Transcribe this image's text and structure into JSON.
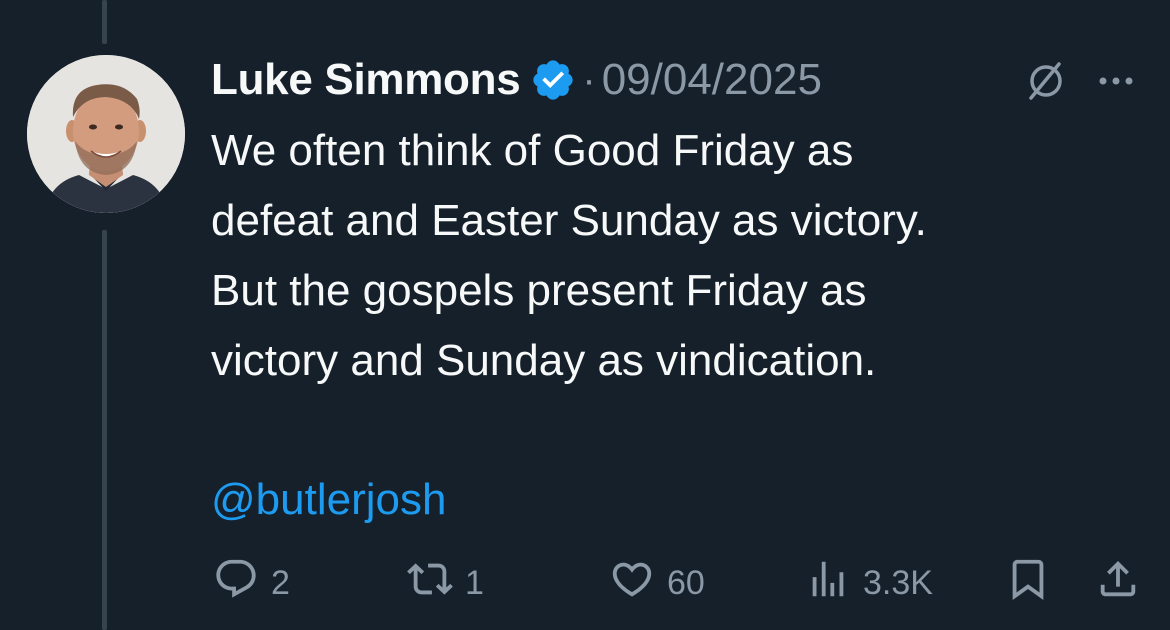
{
  "tweet": {
    "author_name": "Luke Simmons",
    "verified": true,
    "separator": "·",
    "date": "09/04/2025",
    "text": "We often think of Good Friday as\ndefeat and Easter Sunday as victory.\nBut the gospels present Friday as\nvictory and Sunday as vindication.",
    "mention": "@butlerjosh"
  },
  "actions": {
    "replies": "2",
    "reposts": "1",
    "likes": "60",
    "views": "3.3K"
  },
  "icons": {
    "verified": "verified-badge-icon",
    "grok": "grok-icon",
    "more": "more-icon",
    "reply": "reply-icon",
    "repost": "repost-icon",
    "like": "heart-icon",
    "views": "views-icon",
    "bookmark": "bookmark-icon",
    "share": "share-icon"
  },
  "colors": {
    "background": "#15202b",
    "text": "#f7f9f9",
    "muted": "#8b98a5",
    "accent": "#1d9bf0",
    "thread_line": "#38444d"
  }
}
